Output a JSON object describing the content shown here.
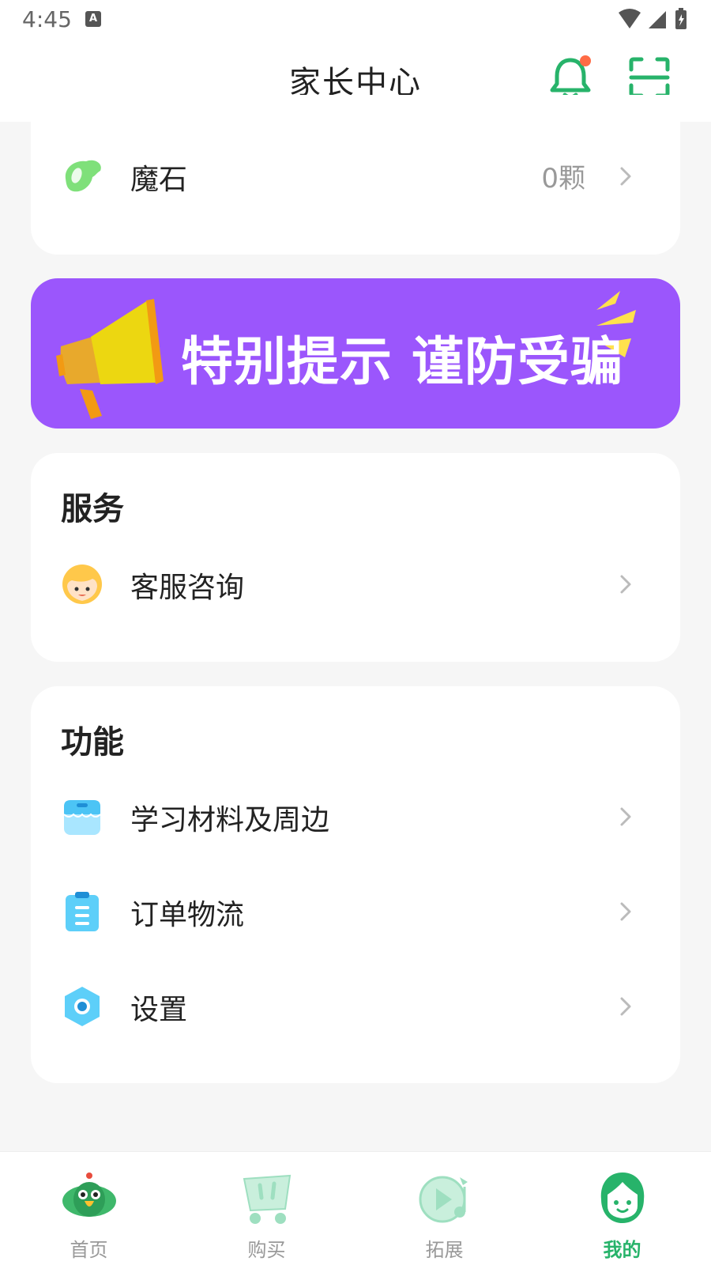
{
  "status_bar": {
    "time": "4:45",
    "notification_icon": "A"
  },
  "header": {
    "title": "家长中心",
    "bell_icon": "bell-icon",
    "scan_icon": "scan-icon",
    "accent": "#27b36a"
  },
  "top_card": {
    "item": {
      "label": "魔石",
      "value": "0颗",
      "icon": "magic-stone-icon"
    }
  },
  "banner": {
    "text": "特别提示 谨防受骗",
    "color": "#9b56fc"
  },
  "service": {
    "title": "服务",
    "items": [
      {
        "label": "客服咨询",
        "icon": "customer-service-avatar-icon"
      }
    ]
  },
  "functions": {
    "title": "功能",
    "items": [
      {
        "label": "学习材料及周边",
        "icon": "store-icon"
      },
      {
        "label": "订单物流",
        "icon": "clipboard-icon"
      },
      {
        "label": "设置",
        "icon": "settings-hexagon-icon"
      }
    ]
  },
  "tabbar": {
    "tabs": [
      {
        "label": "首页",
        "icon": "parrot-home-icon",
        "active": false
      },
      {
        "label": "购买",
        "icon": "cart-icon",
        "active": false
      },
      {
        "label": "拓展",
        "icon": "play-music-icon",
        "active": false
      },
      {
        "label": "我的",
        "icon": "profile-icon",
        "active": true
      }
    ]
  }
}
